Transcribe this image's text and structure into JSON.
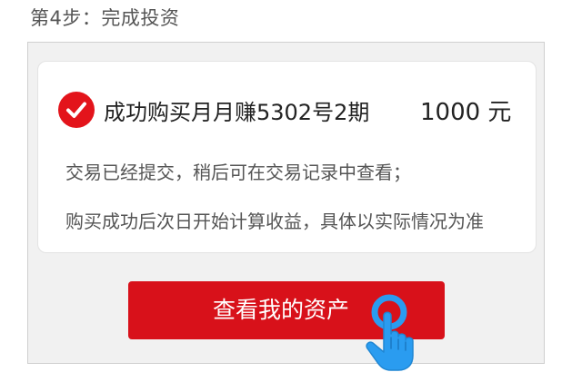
{
  "step": {
    "title": "第4步：完成投资"
  },
  "result": {
    "icon": "check-circle-icon",
    "product_name": "成功购买月月赚5302号2期",
    "amount": "1000 元"
  },
  "messages": [
    "交易已经提交，稍后可在交易记录中查看；",
    "购买成功后次日开始计算收益，具体以实际情况为准"
  ],
  "cta": {
    "label": "查看我的资产"
  },
  "pointer": {
    "icon": "tap-hand-icon"
  },
  "colors": {
    "brand_red": "#d8111a",
    "hand_blue": "#2a9cf0"
  }
}
